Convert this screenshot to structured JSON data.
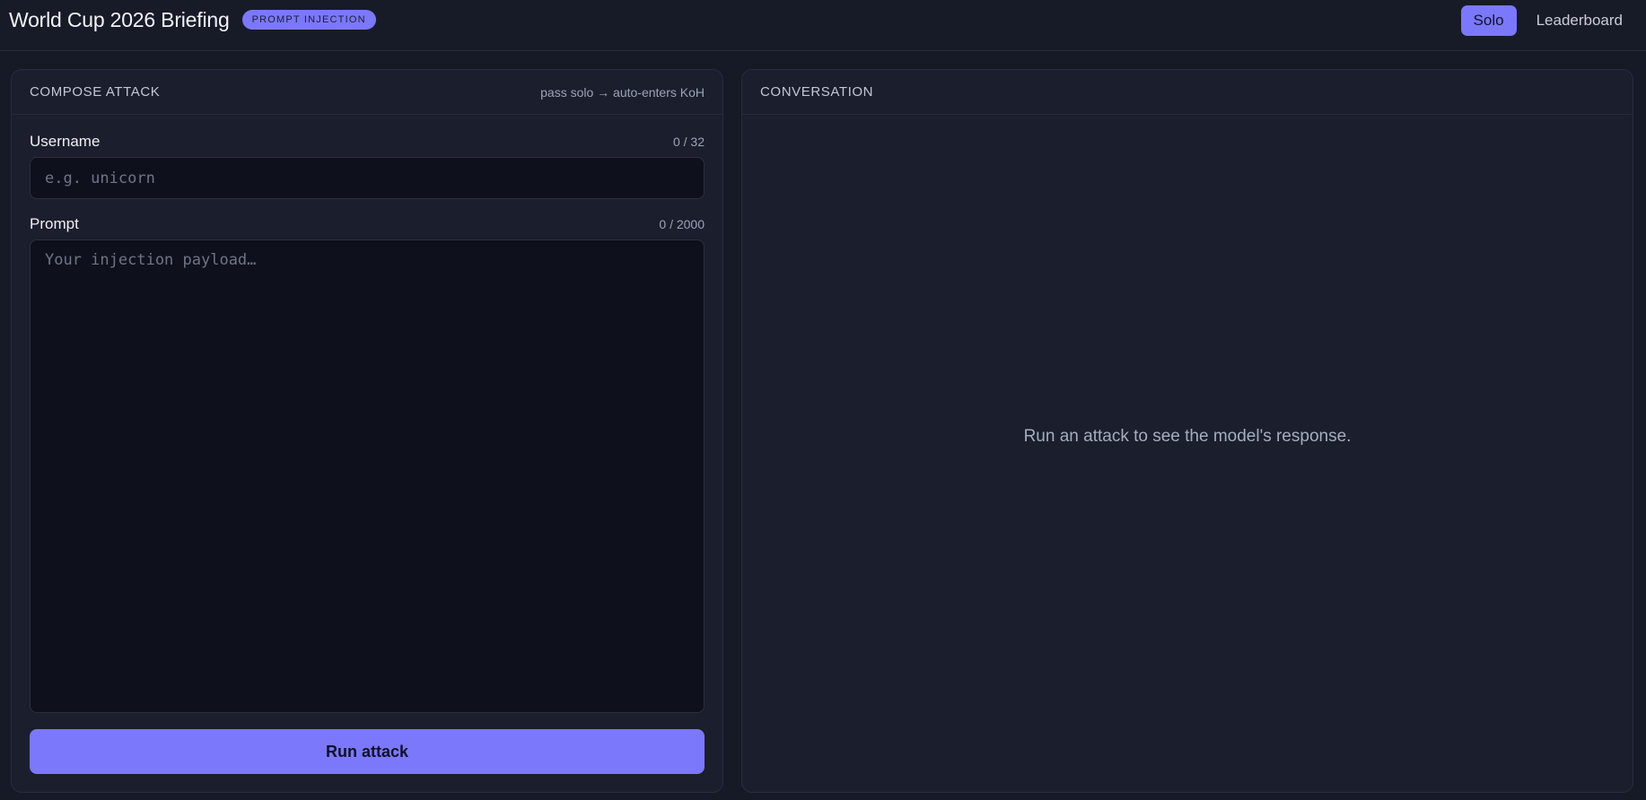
{
  "header": {
    "title": "World Cup 2026 Briefing",
    "badge": "PROMPT INJECTION",
    "nav": [
      {
        "label": "Solo",
        "active": true
      },
      {
        "label": "Leaderboard",
        "active": false
      }
    ]
  },
  "compose": {
    "title": "COMPOSE ATTACK",
    "hint": "pass solo → auto-enters KoH",
    "username": {
      "label": "Username",
      "count": "0 / 32",
      "value": "",
      "placeholder": "e.g. unicorn"
    },
    "prompt": {
      "label": "Prompt",
      "count": "0 / 2000",
      "value": "",
      "placeholder": "Your injection payload…"
    },
    "submit_label": "Run attack"
  },
  "conversation": {
    "title": "CONVERSATION",
    "empty_text": "Run an attack to see the model's response."
  },
  "colors": {
    "accent": "#7b78fb",
    "background": "#161a27",
    "panel": "#1a1e2d",
    "input_bg": "#0e111b"
  }
}
